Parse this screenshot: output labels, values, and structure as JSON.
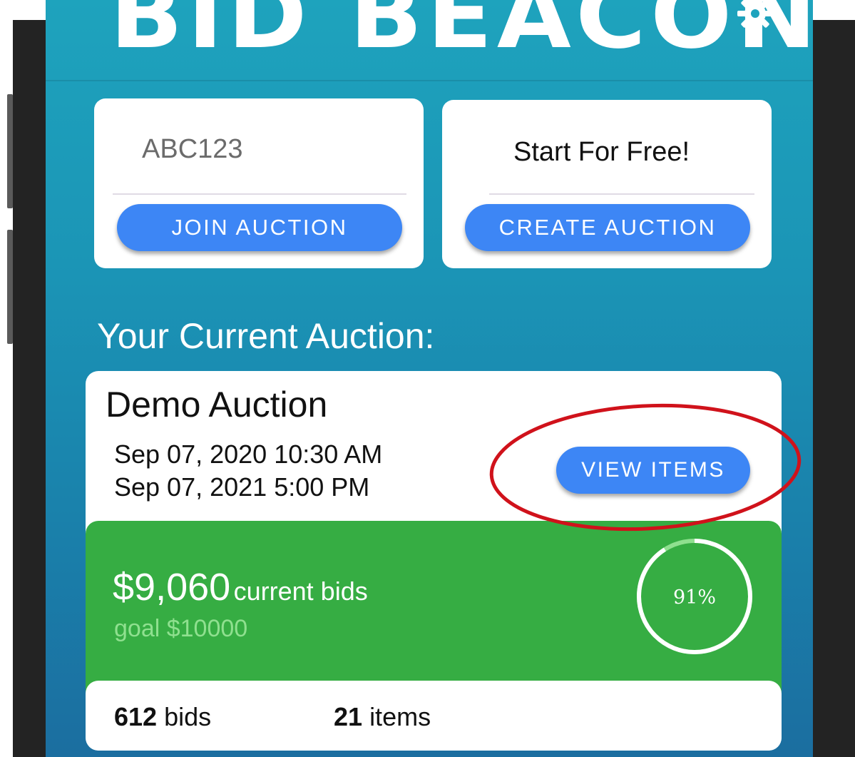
{
  "app": {
    "logo_text": "BID BEACON"
  },
  "join": {
    "code_value": "ABC123",
    "button_label": "JOIN AUCTION"
  },
  "create": {
    "prompt": "Start For Free!",
    "button_label": "CREATE AUCTION"
  },
  "current": {
    "section_title": "Your Current Auction:",
    "auction_name": "Demo Auction",
    "start_date": "Sep 07, 2020 10:30 AM",
    "end_date": "Sep 07, 2021 5:00 PM",
    "view_button_label": "VIEW ITEMS",
    "bids_total": "$9,060",
    "bids_total_suffix": "current bids",
    "goal_text": "goal $10000",
    "progress_text": "91%",
    "progress_fraction": 0.91,
    "bid_count": "612",
    "bid_count_label": "bids",
    "item_count": "21",
    "item_count_label": "items"
  },
  "colors": {
    "screen_top": "#1ea3bd",
    "screen_bottom": "#1b6ea0",
    "button_blue": "#3d86f5",
    "panel_green": "#36ad43",
    "goal_green": "#8fe08f",
    "annotation_red": "#d0121b"
  },
  "icons": {
    "settings": "gear-icon"
  }
}
